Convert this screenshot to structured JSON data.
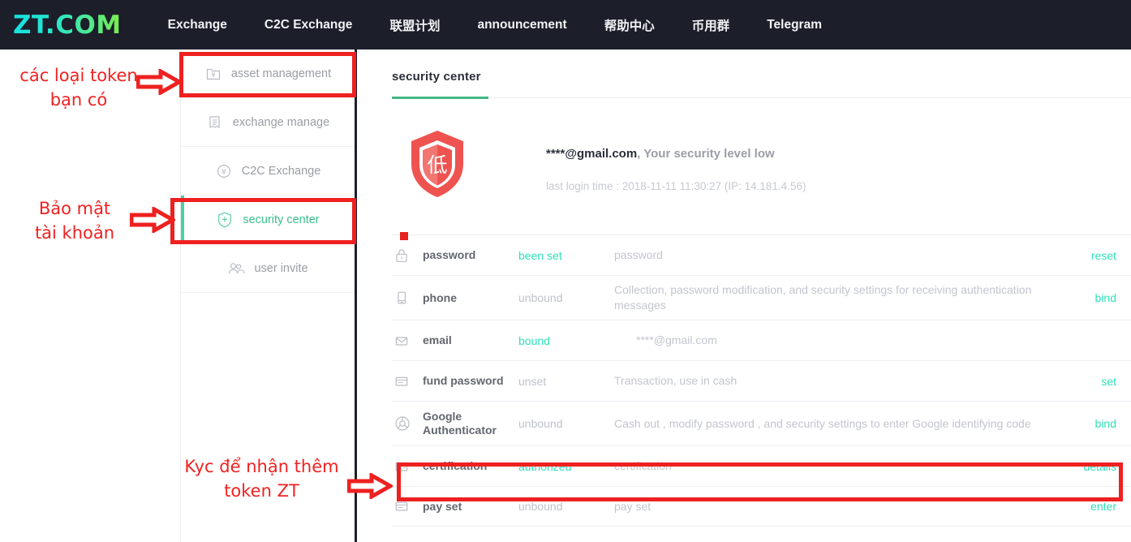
{
  "nav": {
    "logo": "ZT.COM",
    "links": [
      {
        "label": "Exchange"
      },
      {
        "label": "C2C Exchange"
      },
      {
        "label": "联盟计划"
      },
      {
        "label": "announcement"
      },
      {
        "label": "帮助中心"
      },
      {
        "label": "币用群"
      },
      {
        "label": "Telegram"
      }
    ]
  },
  "sidebar": {
    "items": [
      {
        "label": "asset management",
        "icon": "folder-yen-icon",
        "active": false
      },
      {
        "label": "exchange manage",
        "icon": "document-lines-icon",
        "active": false
      },
      {
        "label": "C2C Exchange",
        "icon": "circle-yen-icon",
        "active": false
      },
      {
        "label": "security center",
        "icon": "shield-plus-icon",
        "active": true
      },
      {
        "label": "user invite",
        "icon": "people-icon",
        "active": false
      }
    ]
  },
  "main": {
    "section_title": "security center",
    "shield": {
      "level_char": "低",
      "level_color": "#ef5350"
    },
    "account_masked": "****@gmail.com",
    "account_suffix": ", Your security level low",
    "last_login": "last login time : 2018-11-11 11:30:27 (IP: 14.181.4.56)",
    "rows": [
      {
        "icon": "lock-icon",
        "name": "password",
        "status": "been set",
        "status_ok": true,
        "desc": "password",
        "desc_indent": false,
        "action": "reset"
      },
      {
        "icon": "phone-icon",
        "name": "phone",
        "status": "unbound",
        "status_ok": false,
        "desc": "Collection, password modification, and security settings for receiving authentication messages",
        "desc_indent": false,
        "action": "bind"
      },
      {
        "icon": "envelope-icon",
        "name": "email",
        "status": "bound",
        "status_ok": true,
        "desc": "****@gmail.com",
        "desc_indent": true,
        "action": ""
      },
      {
        "icon": "card-icon",
        "name": "fund password",
        "status": "unset",
        "status_ok": false,
        "desc": "Transaction, use in cash",
        "desc_indent": false,
        "action": "set"
      },
      {
        "icon": "chrome-icon",
        "name": "Google Authenticator",
        "status": "unbound",
        "status_ok": false,
        "desc": "Cash out , modify password , and security settings to enter Google identifying code",
        "desc_indent": false,
        "action": "bind"
      },
      {
        "icon": "id-card-icon",
        "name": "certification",
        "status": "authorized",
        "status_ok": true,
        "desc": "certification",
        "desc_indent": false,
        "action": "details"
      },
      {
        "icon": "card-icon",
        "name": "pay set",
        "status": "unbound",
        "status_ok": false,
        "desc": "pay set",
        "desc_indent": false,
        "action": "enter"
      }
    ]
  },
  "annotations": {
    "color": "#ef2222",
    "notes": [
      {
        "text": "các loại token\nbạn có"
      },
      {
        "text": "Bảo mật\ntài khoản"
      },
      {
        "text": "Kyc để nhận thêm\ntoken ZT"
      }
    ]
  },
  "colors": {
    "nav_bg": "#1c1e2a",
    "accent_teal": "#2ee0b8",
    "accent_green": "#41b883",
    "annotation_red": "#ef2222",
    "shield_red": "#ef5350"
  }
}
